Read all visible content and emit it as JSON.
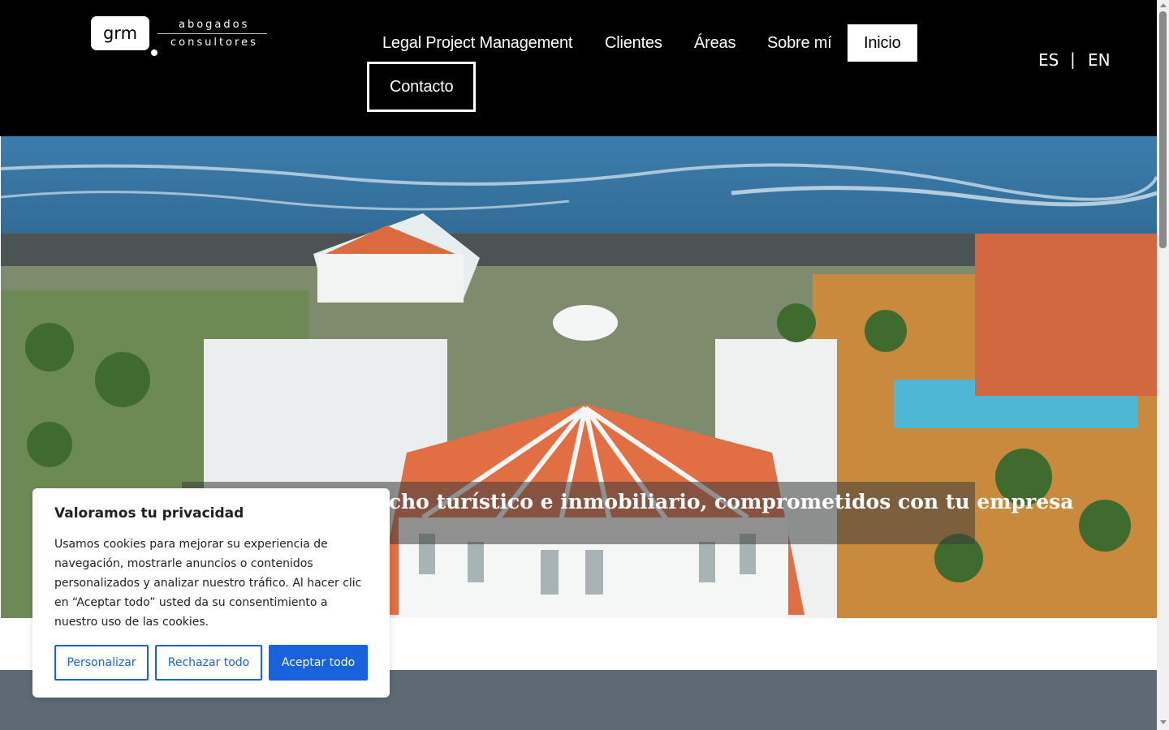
{
  "logo": {
    "mark": "grm",
    "line1": "abogados",
    "line2": "consultores"
  },
  "nav": {
    "items": [
      {
        "label": "Legal Project Management"
      },
      {
        "label": "Clientes"
      },
      {
        "label": "Áreas"
      },
      {
        "label": "Sobre mí"
      },
      {
        "label": "Inicio",
        "active": true
      },
      {
        "label": "Contacto"
      }
    ]
  },
  "languages": {
    "es": "ES",
    "separator": "|",
    "en": "EN"
  },
  "hero": {
    "caption": "Expertos en derecho turístico e inmobiliario, comprometidos con tu empresa"
  },
  "cookie": {
    "title": "Valoramos tu privacidad",
    "text": "Usamos cookies para mejorar su experiencia de navegación, mostrarle anuncios o contenidos personalizados y analizar nuestro tráfico. Al hacer clic en “Aceptar todo” usted da su consentimiento a nuestro uso de las cookies.",
    "customize_label": "Personalizar",
    "reject_label": "Rechazar todo",
    "accept_label": "Aceptar todo"
  },
  "colors": {
    "header_bg": "#000000",
    "accent_blue": "#1863dc",
    "band_grey": "#5d6a74"
  }
}
